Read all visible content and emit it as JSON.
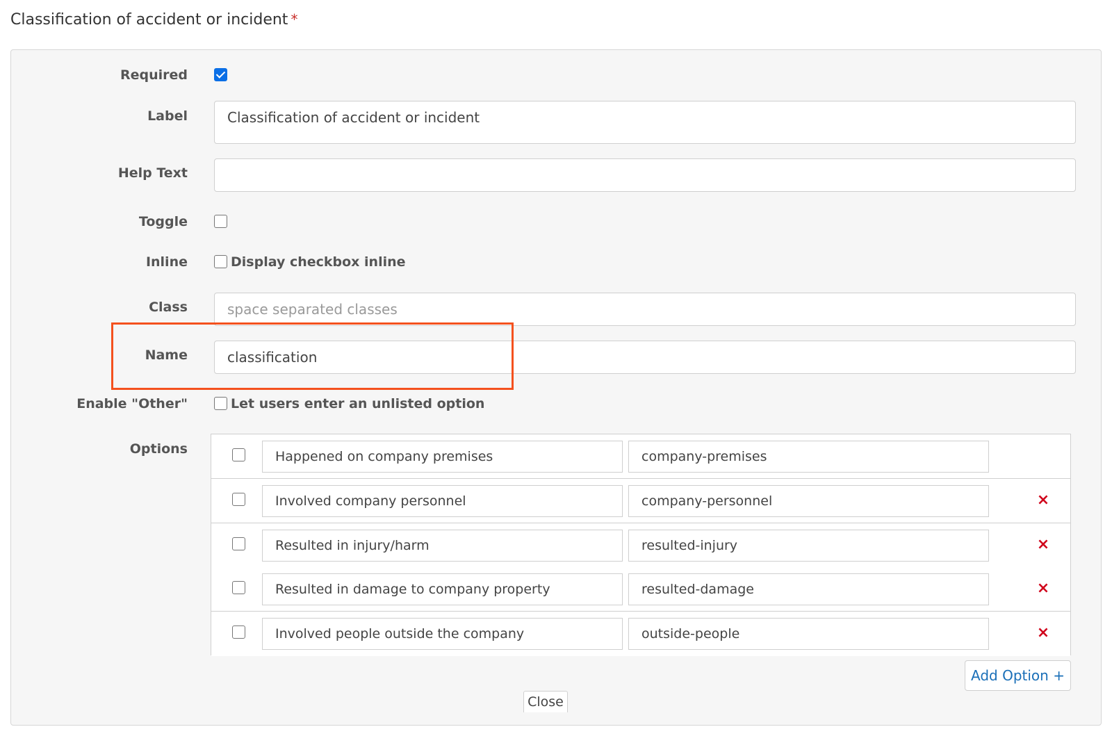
{
  "field": {
    "title": "Classification of accident or incident",
    "required_marker": "*"
  },
  "form": {
    "required": {
      "label": "Required",
      "checked": true
    },
    "label": {
      "label": "Label",
      "value": "Classification of accident or incident"
    },
    "help_text": {
      "label": "Help Text",
      "value": ""
    },
    "toggle": {
      "label": "Toggle",
      "checked": false
    },
    "inline": {
      "label": "Inline",
      "checkbox_text": "Display checkbox inline",
      "checked": false
    },
    "class": {
      "label": "Class",
      "placeholder": "space separated classes",
      "value": ""
    },
    "name": {
      "label": "Name",
      "value": "classification"
    },
    "enable_other": {
      "label": "Enable \"Other\"",
      "checkbox_text": "Let users enter an unlisted option",
      "checked": false
    },
    "options": {
      "label": "Options",
      "items": [
        {
          "label": "Happened on company premises",
          "value": "company-premises",
          "checked": false,
          "removable": false
        },
        {
          "label": "Involved company personnel",
          "value": "company-personnel",
          "checked": false,
          "removable": true
        },
        {
          "label": "Resulted in injury/harm",
          "value": "resulted-injury",
          "checked": false,
          "removable": true
        },
        {
          "label": "Resulted in damage to company property",
          "value": "resulted-damage",
          "checked": false,
          "removable": true
        },
        {
          "label": "Involved people outside the company",
          "value": "outside-people",
          "checked": false,
          "removable": true
        }
      ],
      "remove_icon": "×",
      "add_button": "Add Option +"
    },
    "close_button": "Close"
  },
  "colors": {
    "accent_blue": "#1a6fb8",
    "checkbox_checked": "#0b6fe6",
    "remove_red": "#d0021b",
    "highlight": "#f4511e"
  }
}
